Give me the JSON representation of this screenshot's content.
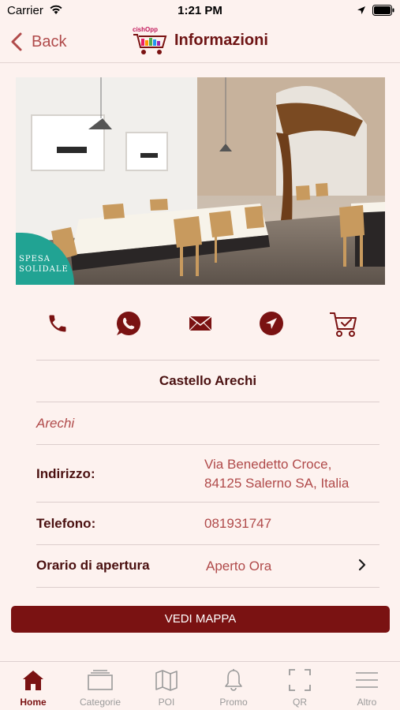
{
  "status_bar": {
    "carrier": "Carrier",
    "time": "1:21 PM"
  },
  "nav": {
    "back_label": "Back",
    "title": "Informazioni",
    "logo_text": "cishOpp"
  },
  "hero": {
    "badge_line1": "SPESA",
    "badge_line2": "SOLIDALE"
  },
  "actions": [
    {
      "icon": "phone-icon"
    },
    {
      "icon": "whatsapp-icon"
    },
    {
      "icon": "mail-icon"
    },
    {
      "icon": "navigation-icon"
    },
    {
      "icon": "cart-check-icon"
    }
  ],
  "venue": {
    "name": "Castello Arechi",
    "subtitle": "Arechi"
  },
  "details": {
    "address_label": "Indirizzo:",
    "address_line1": "Via Benedetto Croce,",
    "address_line2": "84125 Salerno SA, Italia",
    "phone_label": "Telefono:",
    "phone_value": "081931747",
    "hours_label": "Orario di apertura",
    "hours_value": "Aperto Ora"
  },
  "map_button": "VEDI MAPPA",
  "tabs": [
    {
      "label": "Home",
      "icon": "home-icon",
      "active": true
    },
    {
      "label": "Categorie",
      "icon": "categories-icon",
      "active": false
    },
    {
      "label": "POI",
      "icon": "map-icon",
      "active": false
    },
    {
      "label": "Promo",
      "icon": "bell-icon",
      "active": false
    },
    {
      "label": "QR",
      "icon": "qr-scan-icon",
      "active": false
    },
    {
      "label": "Altro",
      "icon": "menu-icon",
      "active": false
    }
  ],
  "colors": {
    "brand": "#7a1212",
    "accent": "#b04a4a",
    "badge": "#21a393",
    "background": "#fdf2ef"
  }
}
